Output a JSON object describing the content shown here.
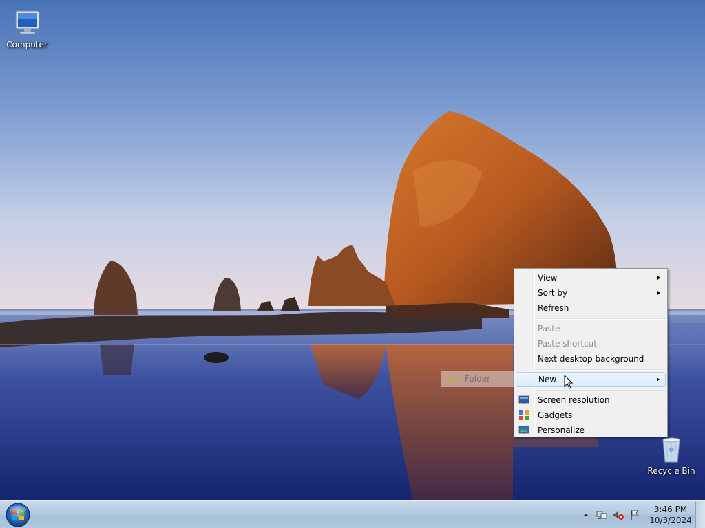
{
  "desktop": {
    "icons": [
      {
        "label": "Computer",
        "icon": "computer-icon"
      },
      {
        "label": "Recycle Bin",
        "icon": "recycle-bin-icon"
      }
    ]
  },
  "context_menu": {
    "items": [
      {
        "label": "View",
        "submenu": true,
        "enabled": true
      },
      {
        "label": "Sort by",
        "submenu": true,
        "enabled": true
      },
      {
        "label": "Refresh",
        "submenu": false,
        "enabled": true
      },
      {
        "label": "Paste",
        "submenu": false,
        "enabled": false
      },
      {
        "label": "Paste shortcut",
        "submenu": false,
        "enabled": false
      },
      {
        "label": "Next desktop background",
        "submenu": false,
        "enabled": true
      },
      {
        "label": "New",
        "submenu": true,
        "enabled": true,
        "highlighted": true
      },
      {
        "label": "Screen resolution",
        "submenu": false,
        "enabled": true,
        "icon": "screen-resolution-icon"
      },
      {
        "label": "Gadgets",
        "submenu": false,
        "enabled": true,
        "icon": "gadgets-icon"
      },
      {
        "label": "Personalize",
        "submenu": false,
        "enabled": true,
        "icon": "personalize-icon"
      }
    ]
  },
  "submenu_ghost": {
    "label": "Folder",
    "icon": "folder-icon"
  },
  "taskbar": {
    "start_icon": "windows-start-orb-icon",
    "tray_icons": [
      "show-hidden-icons-arrow",
      "network-icon",
      "volume-muted-icon",
      "action-center-flag-icon"
    ],
    "clock": {
      "time": "3:46 PM",
      "date": "10/3/2024"
    }
  },
  "colors": {
    "menu_bg": "#f0f0f0",
    "menu_highlight": "#dcebfc",
    "menu_highlight_border": "#aecff7",
    "disabled_text": "#8d8d8d",
    "taskbar": "#b4cbe2"
  }
}
